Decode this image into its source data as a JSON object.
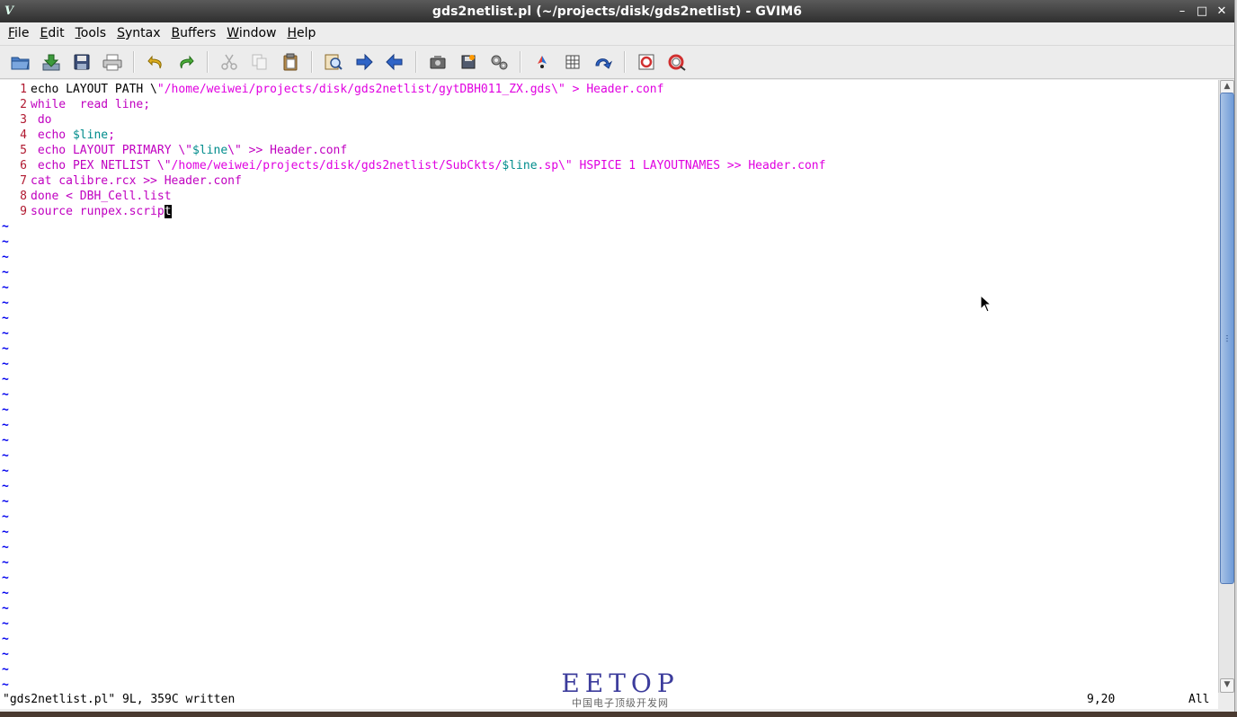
{
  "window": {
    "title": "gds2netlist.pl (~/projects/disk/gds2netlist) - GVIM6",
    "app_icon": "vim-icon",
    "controls": [
      "minimize-icon",
      "maximize-icon",
      "close-icon"
    ]
  },
  "menubar": {
    "items": [
      {
        "label": "File",
        "mnemonic": "F",
        "rest": "ile"
      },
      {
        "label": "Edit",
        "mnemonic": "E",
        "rest": "dit"
      },
      {
        "label": "Tools",
        "mnemonic": "T",
        "rest": "ools"
      },
      {
        "label": "Syntax",
        "mnemonic": "S",
        "rest": "yntax"
      },
      {
        "label": "Buffers",
        "mnemonic": "B",
        "rest": "uffers"
      },
      {
        "label": "Window",
        "mnemonic": "W",
        "rest": "indow"
      },
      {
        "label": "Help",
        "mnemonic": "H",
        "rest": "elp"
      }
    ]
  },
  "toolbar": {
    "icons": [
      "open-icon",
      "save-download-icon",
      "save-icon",
      "print-icon",
      "undo-icon",
      "redo-icon",
      "cut-icon",
      "copy-icon",
      "paste-icon",
      "find-replace-icon",
      "find-next-icon",
      "find-prev-icon",
      "load-session-icon",
      "save-session-icon",
      "run-script-icon",
      "make-icon",
      "table-icon",
      "jump-icon",
      "help-icon",
      "find-help-icon"
    ]
  },
  "editor": {
    "lines": [
      {
        "num": "1",
        "segments": [
          [
            "plain",
            "echo LAYOUT PATH \\"
          ],
          [
            "str",
            "\"/home/weiwei/projects/disk/gds2netlist/gytDBH011_ZX.gds\\\" > Header.conf"
          ]
        ]
      },
      {
        "num": "2",
        "segments": [
          [
            "kw",
            "while  read line;"
          ]
        ]
      },
      {
        "num": "3",
        "segments": [
          [
            "kw",
            " do"
          ]
        ]
      },
      {
        "num": "4",
        "segments": [
          [
            "kw",
            " echo "
          ],
          [
            "var",
            "$line"
          ],
          [
            "kw",
            ";"
          ]
        ]
      },
      {
        "num": "5",
        "segments": [
          [
            "kw",
            " echo LAYOUT PRIMARY \\\""
          ],
          [
            "var",
            "$line"
          ],
          [
            "kw",
            "\\\" >> Header.conf"
          ]
        ]
      },
      {
        "num": "6",
        "segments": [
          [
            "kw",
            " echo PEX NETLIST \\\""
          ],
          [
            "str",
            "/home/weiwei/projects/disk/gds2netlist/SubCkts/"
          ],
          [
            "var",
            "$line"
          ],
          [
            "str",
            ".sp\\\" HSPICE 1 LAYOUTNAMES >> Header.conf"
          ]
        ]
      },
      {
        "num": "7",
        "segments": [
          [
            "kw",
            "cat calibre.rcx >> Header.conf"
          ]
        ]
      },
      {
        "num": "8",
        "segments": [
          [
            "kw",
            "done < DBH_Cell.list"
          ]
        ]
      },
      {
        "num": "9",
        "segments": [
          [
            "kw",
            "source runpex.scrip"
          ],
          [
            "cursor",
            "t"
          ]
        ]
      }
    ],
    "tilde": "~",
    "tilde_count": 31
  },
  "status": {
    "message": "\"gds2netlist.pl\" 9L, 359C written",
    "position": "9,20",
    "scroll": "All"
  },
  "watermark": {
    "brand": "EETOP",
    "tagline": "中国电子顶级开发网"
  }
}
